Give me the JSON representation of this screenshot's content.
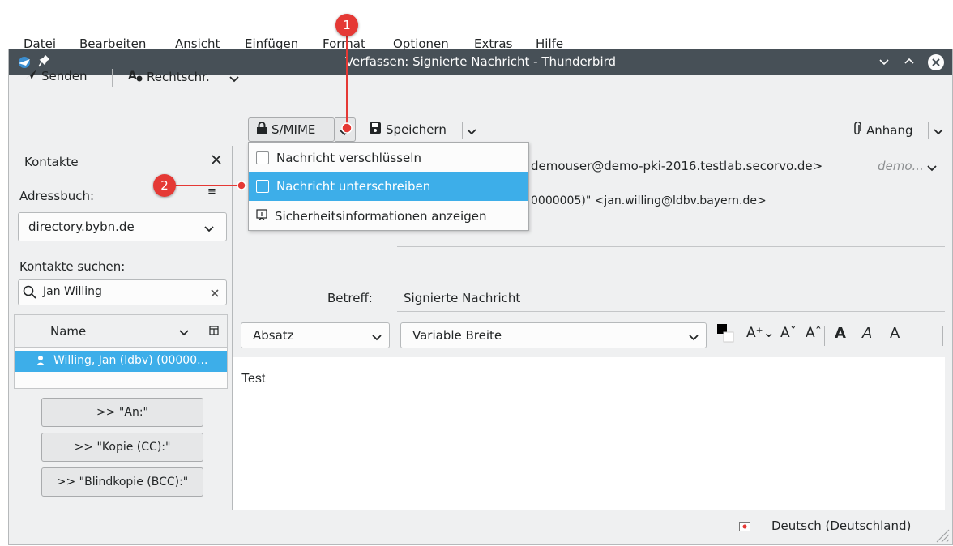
{
  "window": {
    "title": "Verfassen: Signierte Nachricht - Thunderbird"
  },
  "menu": [
    "Datei",
    "Bearbeiten",
    "Ansicht",
    "Einfügen",
    "Format",
    "Optionen",
    "Extras",
    "Hilfe"
  ],
  "toolbar": {
    "send": "Senden",
    "spell": "Rechtschr.",
    "smime": "S/MIME",
    "save": "Speichern",
    "attach": "Anhang"
  },
  "smime_menu": {
    "encrypt": "Nachricht verschlüsseln",
    "sign": "Nachricht unterschreiben",
    "info": "Sicherheitsinformationen anzeigen"
  },
  "contacts": {
    "title": "Kontakte",
    "addressbook_label": "Adressbuch:",
    "addressbook_value": "directory.bybn.de",
    "search_label": "Kontakte suchen:",
    "search_value": "Jan Willing",
    "col_name": "Name",
    "result": "Willing, Jan (ldbv) (00000...",
    "btn_to": ">> \"An:\"",
    "btn_cc": ">> \"Kopie (CC):\"",
    "btn_bcc": ">> \"Blindkopie (BCC):\""
  },
  "header": {
    "from": "demouser@demo-pki-2016.testlab.secorvo.de>",
    "from_hint": "demo...",
    "to": "0000005)\" <jan.willing@ldbv.bayern.de>",
    "subject_label": "Betreff:",
    "subject": "Signierte Nachricht"
  },
  "format": {
    "paragraph": "Absatz",
    "font": "Variable Breite"
  },
  "body": "Test",
  "status": {
    "language": "Deutsch (Deutschland)"
  },
  "callouts": [
    "1",
    "2"
  ]
}
